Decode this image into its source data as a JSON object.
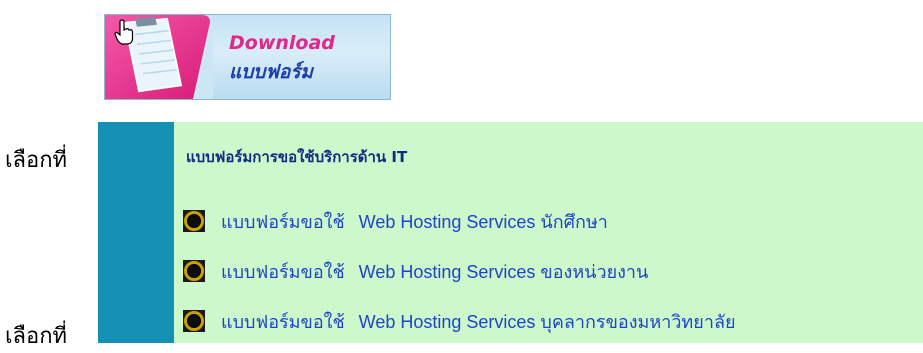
{
  "steps": [
    {
      "label": "เลือกที่"
    },
    {
      "label": "เลือกที่"
    }
  ],
  "banner": {
    "line1": "Download",
    "line2": "แบบฟอร์ม"
  },
  "panel": {
    "title": "แบบฟอร์มการขอใช้บริการด้าน   IT",
    "items": [
      {
        "prefix": "แบบฟอร์มขอใช้",
        "text": "Web Hosting Services นักศึกษา"
      },
      {
        "prefix": "แบบฟอร์มขอใช้",
        "text": "Web Hosting Services ของหน่วยงาน"
      },
      {
        "prefix": "แบบฟอร์มขอใช้",
        "text": "Web Hosting Services บุคลากรของมหาวิทยาลัย"
      }
    ]
  },
  "colors": {
    "sidebar": "#1490b5",
    "panel_bg": "#ccf8cc",
    "link": "#1d44c9",
    "title": "#0f2d85"
  }
}
